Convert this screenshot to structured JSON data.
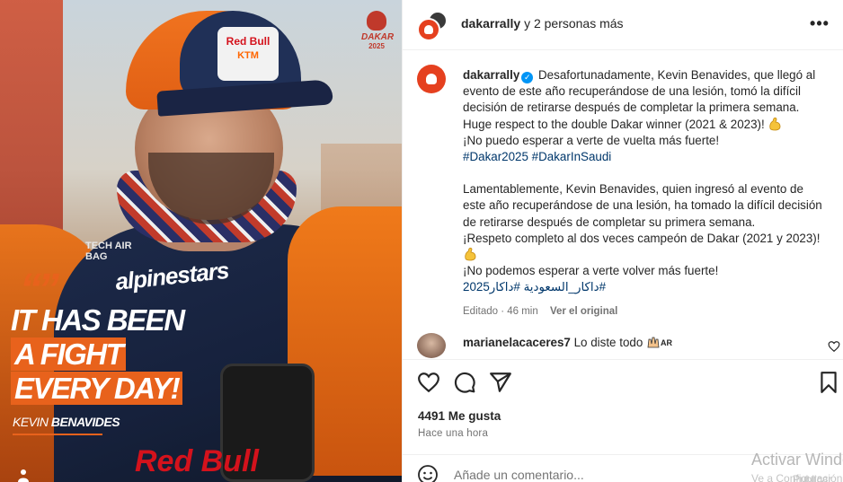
{
  "image": {
    "badge_word": "DAKAR",
    "badge_year": "2025",
    "cap_logo_top": "Red Bull",
    "cap_logo_bottom": "KTM",
    "sponsor_text": "alpinestars",
    "airbag_text": "TECH AIR BAG",
    "bottom_brand": "Red Bull",
    "quote_mark": "“”",
    "headline_lines": [
      "IT HAS BEEN",
      "A FIGHT",
      "EVERY DAY!"
    ],
    "name_first": "KEVIN",
    "name_last": "BENAVIDES"
  },
  "header": {
    "username": "dakarrally",
    "others": "y 2 personas más",
    "more_label": "•••"
  },
  "caption": {
    "username": "dakarrally",
    "p1": "Desafortunadamente, Kevin Benavides, que llegó al evento de este año recuperándose de una lesión, tomó la difícil decisión de retirarse después de completar la primera semana.",
    "p2": "Huge respect to the double Dakar winner (2021 & 2023)!",
    "p3": "¡No puedo esperar a verte de vuelta más fuerte!",
    "tags1": "#Dakar2025 #DakarInSaudi",
    "p4": "Lamentablemente, Kevin Benavides, quien ingresó al evento de este año recuperándose de una lesión, ha tomado la difícil decisión de retirarse después de completar su primera semana.",
    "p5": "¡Respeto completo al dos veces campeón de Dakar (2021 y 2023)!",
    "p6": "¡No podemos esperar a verte volver más fuerte!",
    "tags2": "#داكار_السعودية #داكار2025",
    "edited": "Editado · 46 min",
    "see_original": "Ver el original"
  },
  "comment": {
    "username": "marianelacaceres7",
    "text": "Lo diste todo",
    "flag": "AR"
  },
  "stats": {
    "likes": "4491 Me gusta",
    "time": "Hace una hora"
  },
  "add_comment": {
    "placeholder": "Añade un comentario..."
  },
  "watermark": {
    "line1": "Activar Windows",
    "line2": "Ve a Configuración",
    "publish": "Publicar"
  },
  "colors": {
    "accent_orange": "#e8621c",
    "link_blue": "#00376b",
    "verified_blue": "#0095f6",
    "dakar_red": "#e5401f"
  }
}
